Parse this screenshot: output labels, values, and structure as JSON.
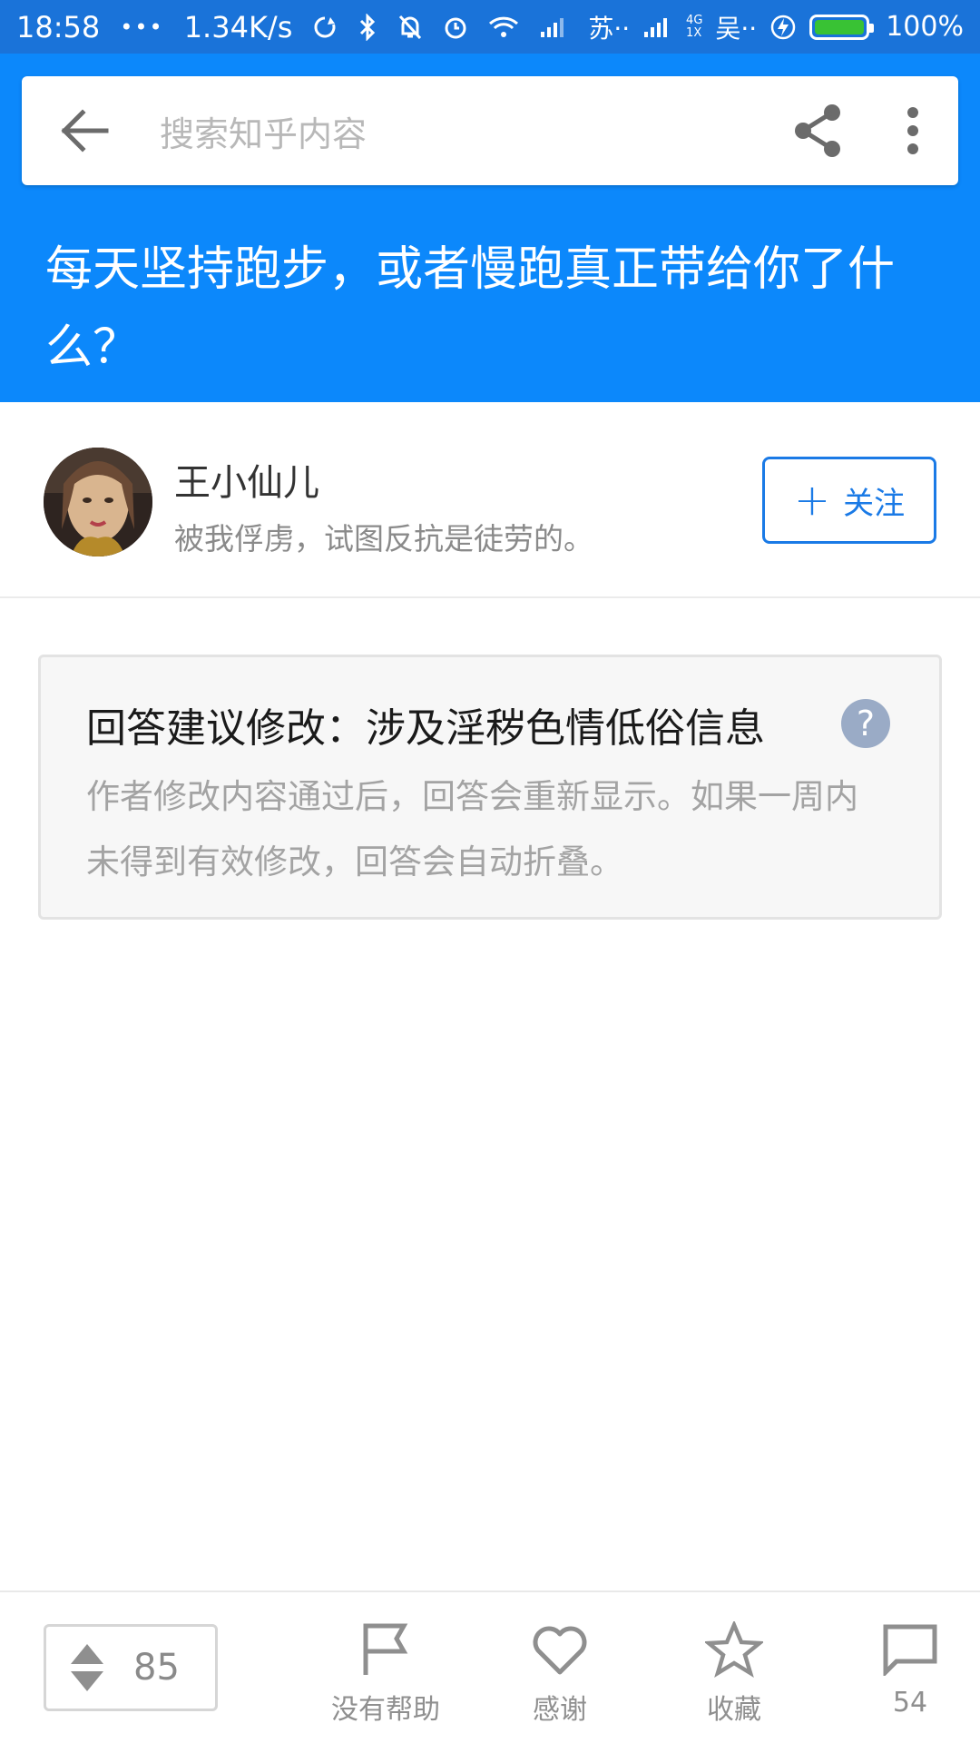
{
  "status_bar": {
    "time": "18:58",
    "dots": "•••",
    "net_speed": "1.34K/s",
    "carrier1": "苏··",
    "net_type": "4G",
    "net_type2": "1X",
    "carrier2": "吴··",
    "battery_percent": "100%",
    "battery_level": 1.0,
    "battery_color": "#39c234"
  },
  "search": {
    "placeholder": "搜索知乎内容"
  },
  "question": {
    "title": "每天坚持跑步，或者慢跑真正带给你了什么？"
  },
  "author": {
    "name": "王小仙儿",
    "bio": "被我俘虏，试图反抗是徒劳的。",
    "follow_label": "关注",
    "follow_plus": "+"
  },
  "notice": {
    "title": "回答建议修改：涉及淫秽色情低俗信息",
    "help_symbol": "?",
    "body": "作者修改内容通过后，回答会重新显示。如果一周内未得到有效修改，回答会自动折叠。"
  },
  "bottom_bar": {
    "vote_count": "85",
    "actions": [
      {
        "label": "没有帮助",
        "icon": "flag-icon"
      },
      {
        "label": "感谢",
        "icon": "heart-icon"
      },
      {
        "label": "收藏",
        "icon": "star-icon"
      },
      {
        "label": "54",
        "icon": "comment-icon"
      }
    ]
  },
  "colors": {
    "header_blue": "#0c88fb",
    "status_blue": "#1a73d9",
    "accent_blue": "#1a7ae6"
  }
}
